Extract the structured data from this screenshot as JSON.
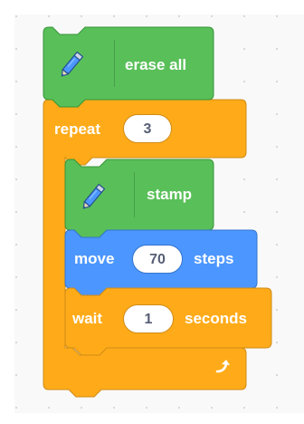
{
  "colors": {
    "pen": "#59c059",
    "pen_border": "#389438",
    "control": "#ffab19",
    "control_border": "#cf8b17",
    "motion": "#4c97ff",
    "motion_border": "#3373cc"
  },
  "blocks": {
    "erase_all": {
      "label": "erase all",
      "icon": "pen-icon"
    },
    "repeat": {
      "label": "repeat",
      "value": "3",
      "end_icon": "loop-arrow-icon"
    },
    "stamp": {
      "label": "stamp",
      "icon": "pen-icon"
    },
    "move": {
      "label": "move",
      "value": "70",
      "suffix": "steps"
    },
    "wait": {
      "label": "wait",
      "value": "1",
      "suffix": "seconds"
    }
  }
}
